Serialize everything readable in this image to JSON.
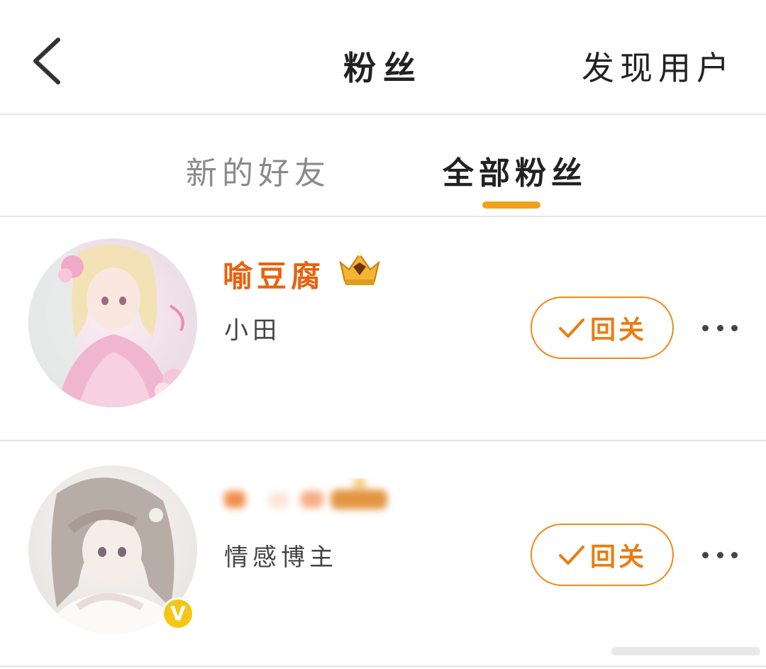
{
  "header": {
    "title": "粉丝",
    "discover_label": "发现用户"
  },
  "tabs": [
    {
      "label": "新的好友",
      "active": false
    },
    {
      "label": "全部粉丝",
      "active": true
    }
  ],
  "colors": {
    "accent": "#f0a31a",
    "name_orange": "#e8620e",
    "follow_text": "#e87d12",
    "v_badge": "#f5c518"
  },
  "fans": [
    {
      "name": "喻豆腐",
      "badge": "crown-icon",
      "subtitle": "小田",
      "follow_label": "回关",
      "verified": false
    },
    {
      "name": "",
      "subtitle": "情感博主",
      "follow_label": "回关",
      "verified": true,
      "verified_mark": "V"
    }
  ]
}
